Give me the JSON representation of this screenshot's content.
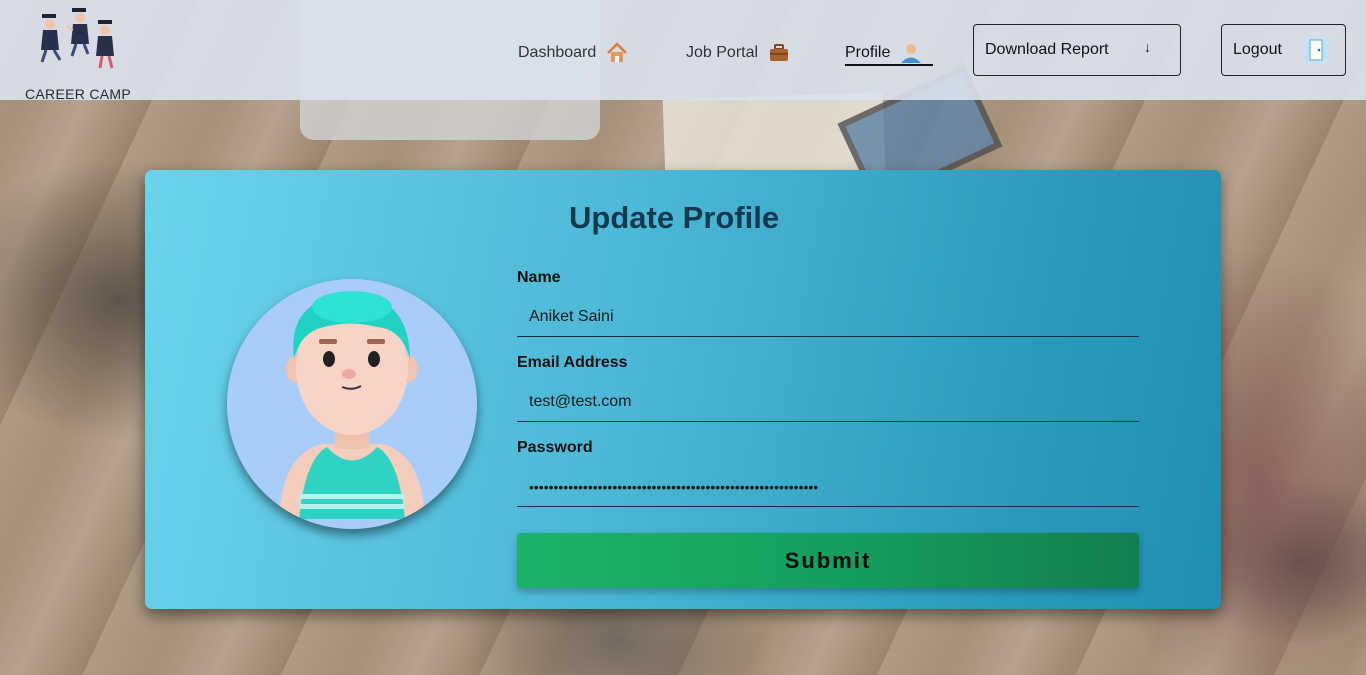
{
  "brand": {
    "name": "CAREER CAMP",
    "logo_icon": "graduates-jumping-icon"
  },
  "nav": {
    "items": [
      {
        "label": "Dashboard",
        "icon": "house-icon"
      },
      {
        "label": "Job Portal",
        "icon": "briefcase-icon"
      },
      {
        "label": "Profile",
        "icon": "user-icon",
        "active": true
      }
    ],
    "download_label": "Download Report",
    "download_icon": "↓",
    "logout_label": "Logout",
    "logout_icon": "door-icon"
  },
  "form": {
    "title": "Update Profile",
    "name_label": "Name",
    "name_value": "Aniket Saini",
    "email_label": "Email Address",
    "email_value": "test@test.com",
    "password_label": "Password",
    "password_value": "abcdefghijklmnopqrstuvwxyz0123456789abcdefghijklmnopqrstuvw",
    "submit_label": "Submit",
    "avatar_icon": "avatar-3d-boy-icon"
  },
  "colors": {
    "card_gradient_start": "#6bd3ec",
    "card_gradient_end": "#1f8eb2",
    "submit_green": "#1bb36a",
    "title_color": "#14394f"
  }
}
